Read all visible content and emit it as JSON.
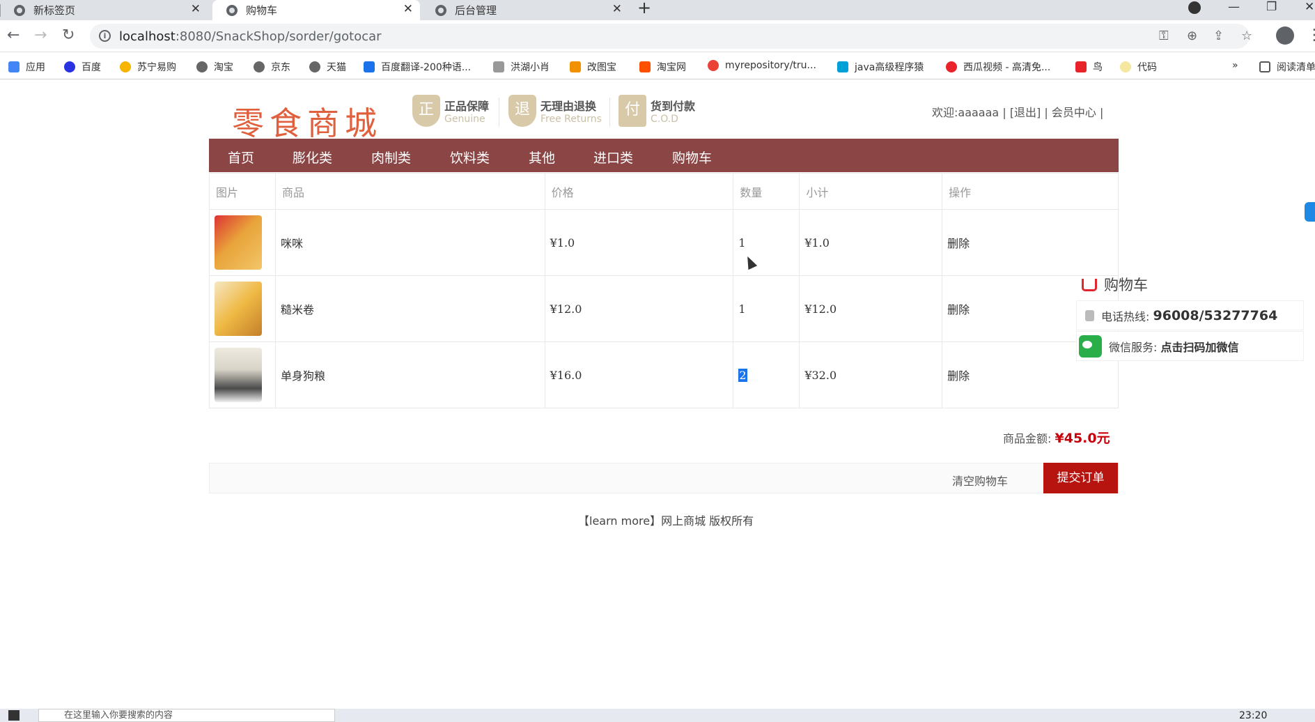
{
  "browser": {
    "tabs": [
      {
        "label": "新标签页"
      },
      {
        "label": "购物车"
      },
      {
        "label": "后台管理"
      }
    ],
    "url_host": "localhost",
    "url_rest": ":8080/SnackShop/sorder/gotocar",
    "bookmarks": [
      "应用",
      "百度",
      "苏宁易购",
      "淘宝",
      "京东",
      "天猫",
      "百度翻译-200种语...",
      "洪湖小肖",
      "改图宝",
      "淘宝网",
      "myrepository/tru...",
      "java高级程序猿",
      "西瓜视频 - 高清免...",
      "鸟",
      "代码",
      "阅读清单"
    ],
    "bookmarks_more": "»"
  },
  "header": {
    "logo": "零食商城",
    "badges": [
      {
        "icon": "正",
        "title": "正品保障",
        "sub": "Genuine"
      },
      {
        "icon": "退",
        "title": "无理由退换",
        "sub": "Free Returns"
      },
      {
        "icon": "付",
        "title": "货到付款",
        "sub": "C.O.D"
      }
    ],
    "welcome": "欢迎:aaaaaa",
    "logout": "[退出]",
    "member_center": "会员中心",
    "sep": "|"
  },
  "nav": [
    "首页",
    "膨化类",
    "肉制类",
    "饮料类",
    "其他",
    "进口类",
    "购物车"
  ],
  "cart": {
    "columns": [
      "图片",
      "商品",
      "价格",
      "数量",
      "小计",
      "操作"
    ],
    "rows": [
      {
        "name": "咪咪",
        "price": "¥1.0",
        "qty": "1",
        "subtotal": "¥1.0",
        "action": "删除",
        "img_color": "#e8a33a"
      },
      {
        "name": "糙米卷",
        "price": "¥12.0",
        "qty": "1",
        "subtotal": "¥12.0",
        "action": "删除",
        "img_color": "#efb944"
      },
      {
        "name": "单身狗粮",
        "price": "¥16.0",
        "qty": "2",
        "subtotal": "¥32.0",
        "action": "删除",
        "img_color": "#d9d4c8"
      }
    ],
    "total_label": "商品金额:",
    "total_value": "¥45.0元",
    "clear_label": "清空购物车",
    "submit_label": "提交订单"
  },
  "footer": "【learn more】网上商城 版权所有",
  "side_panel": {
    "title": "购物车",
    "hotline_label": "电话热线:",
    "hotline_value": "96008/53277764",
    "wechat_label": "微信服务:",
    "wechat_value": "点击扫码加微信"
  },
  "taskbar": {
    "search_placeholder": "在这里输入你要搜索的内容",
    "time": "23:20"
  },
  "colors": {
    "nav_bg": "#8b4545",
    "submit_bg": "#b8140f",
    "total_color": "#c7000b",
    "logo_color": "#e0603e"
  }
}
